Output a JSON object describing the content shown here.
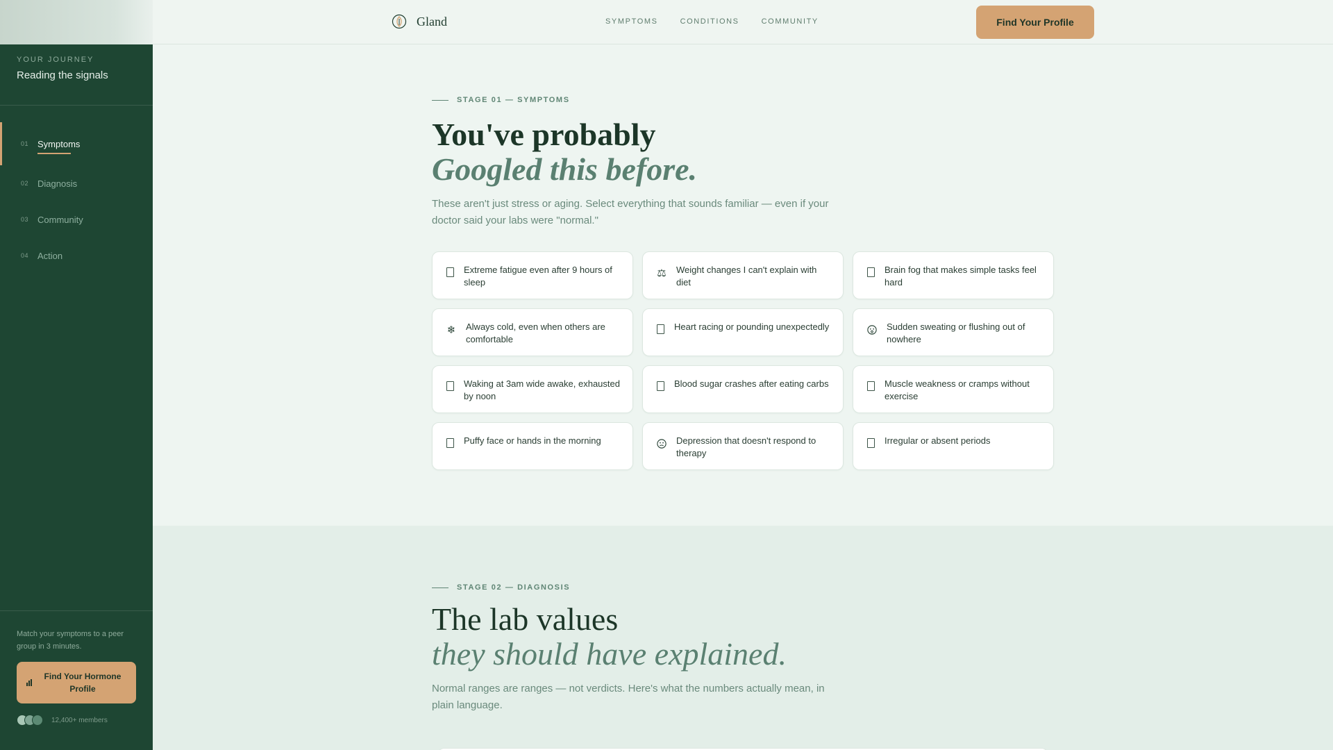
{
  "sidebar": {
    "kicker": "YOUR JOURNEY",
    "title": "Reading the signals",
    "items": [
      {
        "num": "01",
        "label": "Symptoms"
      },
      {
        "num": "02",
        "label": "Diagnosis"
      },
      {
        "num": "03",
        "label": "Community"
      },
      {
        "num": "04",
        "label": "Action"
      }
    ],
    "note": "Match your symptoms to a peer group in 3 minutes.",
    "cta": "Find Your Hormone Profile",
    "members": "12,400+ members"
  },
  "header": {
    "brand": "Gland",
    "nav": [
      "SYMPTOMS",
      "CONDITIONS",
      "COMMUNITY"
    ],
    "cta": "Find Your Profile"
  },
  "stage1": {
    "kicker": "STAGE 01 — SYMPTOMS",
    "title": "You've probably",
    "title_em": "Googled this before.",
    "lede": "These aren't just stress or aging. Select everything that sounds familiar — even if your doctor said your labs were \"normal.\"",
    "symptoms": [
      {
        "icon": "checkbox",
        "text": "Extreme fatigue even after 9 hours of sleep"
      },
      {
        "icon": "scale",
        "text": "Weight changes I can't explain with diet"
      },
      {
        "icon": "checkbox",
        "text": "Brain fog that makes simple tasks feel hard"
      },
      {
        "icon": "snowflake",
        "text": "Always cold, even when others are comfortable"
      },
      {
        "icon": "checkbox",
        "text": "Heart racing or pounding unexpectedly"
      },
      {
        "icon": "flushed-face",
        "text": "Sudden sweating or flushing out of nowhere"
      },
      {
        "icon": "checkbox",
        "text": "Waking at 3am wide awake, exhausted by noon"
      },
      {
        "icon": "checkbox",
        "text": "Blood sugar crashes after eating carbs"
      },
      {
        "icon": "checkbox",
        "text": "Muscle weakness or cramps without exercise"
      },
      {
        "icon": "checkbox",
        "text": "Puffy face or hands in the morning"
      },
      {
        "icon": "sad-face",
        "text": "Depression that doesn't respond to therapy"
      },
      {
        "icon": "checkbox",
        "text": "Irregular or absent periods"
      }
    ]
  },
  "stage2": {
    "kicker": "STAGE 02 — DIAGNOSIS",
    "title": "The lab values",
    "title_em": "they should have explained.",
    "lede": "Normal ranges are ranges — not verdicts. Here's what the numbers actually mean, in plain language."
  },
  "colors": {
    "sidebar": "#1e4633",
    "accent": "#d4a373",
    "heading": "#1c3628",
    "muted": "#6a8a7c"
  }
}
